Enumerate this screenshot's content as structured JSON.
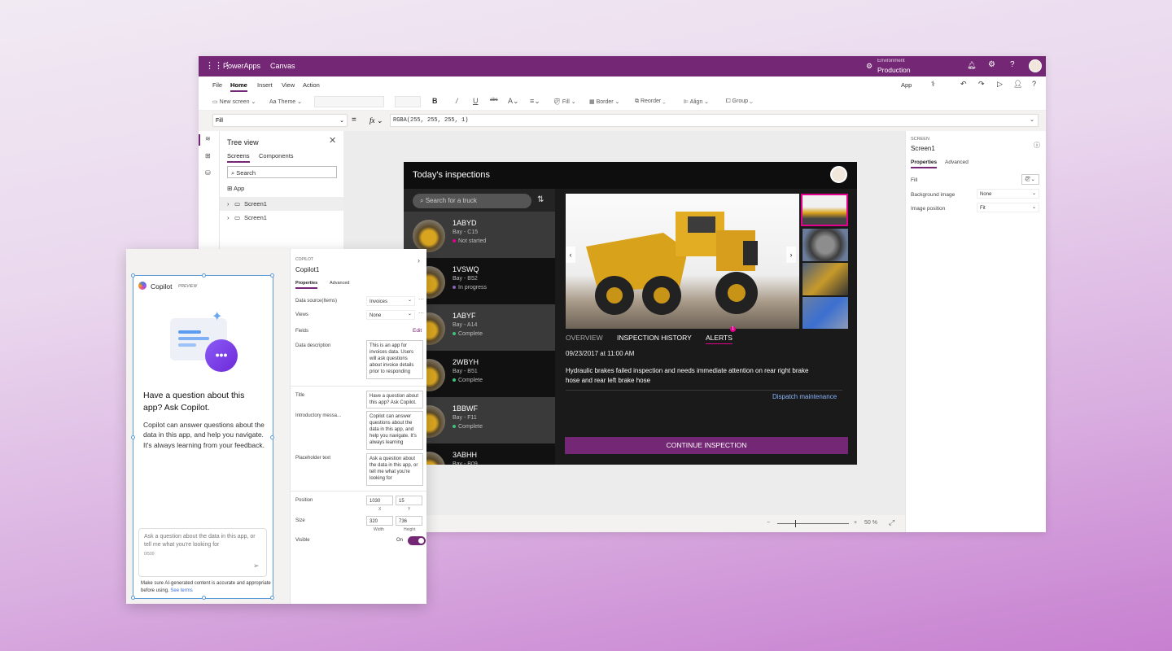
{
  "window": {
    "app_name": "PowerApps",
    "app_type": "Canvas",
    "environment_label": "Environment",
    "environment_name": "Production"
  },
  "menu": {
    "items": [
      "File",
      "Home",
      "Insert",
      "View",
      "Action"
    ],
    "active": "Home",
    "app_label": "App"
  },
  "toolbar": {
    "new_screen": "New screen",
    "theme": "Theme",
    "bold": "B",
    "italic": "/",
    "underline": "U",
    "strike": "abc",
    "font_size": "A",
    "fill": "Fill",
    "border": "Border",
    "reorder": "Reorder",
    "align": "Align",
    "group": "Group"
  },
  "formula_bar": {
    "property": "Fill",
    "equals": "=",
    "fx": "fx",
    "formula": "RGBA(255, 255, 255, 1)"
  },
  "tree": {
    "title": "Tree view",
    "tabs": [
      "Screens",
      "Components"
    ],
    "search_placeholder": "Search",
    "app_item": "App",
    "screens": [
      "Screen1",
      "Screen1"
    ]
  },
  "properties": {
    "section": "SCREEN",
    "name": "Screen1",
    "tabs": [
      "Properties",
      "Advanced"
    ],
    "rows": [
      {
        "label": "Fill",
        "value": ""
      },
      {
        "label": "Background image",
        "value": "None"
      },
      {
        "label": "Image position",
        "value": "Fit"
      }
    ]
  },
  "preview": {
    "title": "Today's inspections",
    "search_placeholder": "Search for a truck",
    "trucks": [
      {
        "id": "1ABYD",
        "bay": "Bay - C15",
        "status": "Not started",
        "color": "#e3008c"
      },
      {
        "id": "1VSWQ",
        "bay": "Bay - B52",
        "status": "In progress",
        "color": "#8764b8"
      },
      {
        "id": "1ABYF",
        "bay": "Bay - A14",
        "status": "Complete",
        "color": "#3ec27e"
      },
      {
        "id": "2WBYH",
        "bay": "Bay - B51",
        "status": "Complete",
        "color": "#3ec27e"
      },
      {
        "id": "1BBWF",
        "bay": "Bay - F11",
        "status": "Complete",
        "color": "#3ec27e"
      },
      {
        "id": "3ABHH",
        "bay": "Bay - B09",
        "status": "",
        "color": "#3ec27e"
      }
    ],
    "tabs": [
      "OVERVIEW",
      "INSPECTION HISTORY",
      "ALERTS"
    ],
    "active_tab": "ALERTS",
    "alert_count": "1",
    "date": "09/23/2017 at 11:00 AM",
    "message": "Hydraulic brakes failed inspection and needs immediate attention on rear right brake hose and rear left brake hose",
    "dispatch": "Dispatch maintenance",
    "continue": "CONTINUE INSPECTION"
  },
  "zoom": {
    "minus": "−",
    "plus": "+",
    "value": "50",
    "unit": "%",
    "level": 0.5
  },
  "copilot": {
    "name": "Copilot",
    "badge": "PREVIEW",
    "heading": "Have a question about this app? Ask Copilot.",
    "body": "Copilot can answer questions about the data in this app, and help you navigate. It's always learning from your feedback.",
    "input_placeholder": "Ask a question about the data in this app, or tell me what you're looking for",
    "counter": "0/500",
    "disclaimer": "Make sure AI-generated content is accurate and appropriate before using.",
    "see_terms": "See terms"
  },
  "copilot_props": {
    "section": "COPILOT",
    "name": "Copilot1",
    "tabs": [
      "Properties",
      "Advanced"
    ],
    "data_source_label": "Data source(Items)",
    "data_source_value": "Invoices",
    "views_label": "Views",
    "views_value": "None",
    "fields_label": "Fields",
    "fields_action": "Edit",
    "data_desc_label": "Data description",
    "data_desc_value": "This is an app for invoices data. Users will ask questions about invoice details prior to responding",
    "title_label": "Title",
    "title_value": "Have a question about this app? Ask Copilot.",
    "intro_label": "Introductory messa...",
    "intro_value": "Copilot can answer questions about the data in this app, and help you navigate. It's always learning",
    "placeholder_label": "Placeholder text",
    "placeholder_value": "Ask a question about the data in this app, or tell me what you're looking for",
    "position_label": "Position",
    "x": "1030",
    "y": "15",
    "x_label": "X",
    "y_label": "Y",
    "size_label": "Size",
    "width": "320",
    "height": "736",
    "width_label": "Width",
    "height_label": "Height",
    "visible_label": "Visible",
    "visible_value": "On"
  },
  "colors": {
    "brand": "#742774",
    "accent_pink": "#e3008c",
    "link": "#8ab4f8"
  }
}
